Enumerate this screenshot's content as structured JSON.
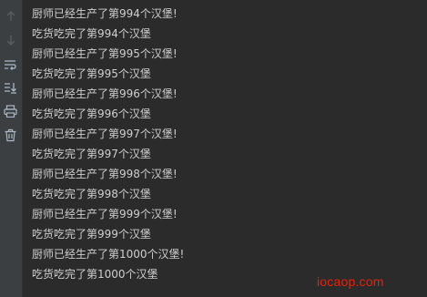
{
  "toolbar": {
    "icons": [
      "arrow-up-icon",
      "arrow-down-icon",
      "soft-wrap-icon",
      "scroll-to-end-icon",
      "print-icon",
      "trash-icon"
    ]
  },
  "console": {
    "lines": [
      "厨师已经生产了第994个汉堡!",
      "吃货吃完了第994个汉堡",
      "厨师已经生产了第995个汉堡!",
      "吃货吃完了第995个汉堡",
      "厨师已经生产了第996个汉堡!",
      "吃货吃完了第996个汉堡",
      "厨师已经生产了第997个汉堡!",
      "吃货吃完了第997个汉堡",
      "厨师已经生产了第998个汉堡!",
      "吃货吃完了第998个汉堡",
      "厨师已经生产了第999个汉堡!",
      "吃货吃完了第999个汉堡",
      "厨师已经生产了第1000个汉堡!",
      "吃货吃完了第1000个汉堡"
    ]
  },
  "watermark": {
    "text": "iocaop.com"
  },
  "colors": {
    "background": "#2b2b2b",
    "gutter": "#3c3f41",
    "text": "#cfcfcf",
    "watermark": "#e8210c"
  }
}
